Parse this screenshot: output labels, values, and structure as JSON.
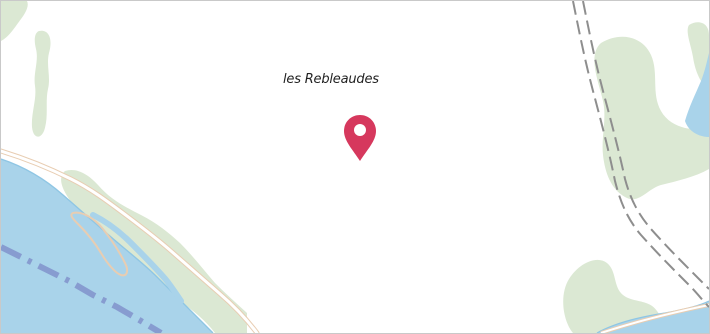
{
  "map": {
    "place_label": "les Rebleaudes",
    "marker_icon": "map-pin-icon",
    "colors": {
      "background": "#ffffff",
      "water": "#a9d3ea",
      "water_edge": "#8fc6e4",
      "woodland": "#dbe8d3",
      "woodland_edge": "#cfe0c6",
      "road_casing": "#e8cdb2",
      "road_fill": "#ffffff",
      "railway_dash": "#8e8e8e",
      "boundary_dash": "#7e8fc9",
      "marker": "#d6385d"
    }
  }
}
